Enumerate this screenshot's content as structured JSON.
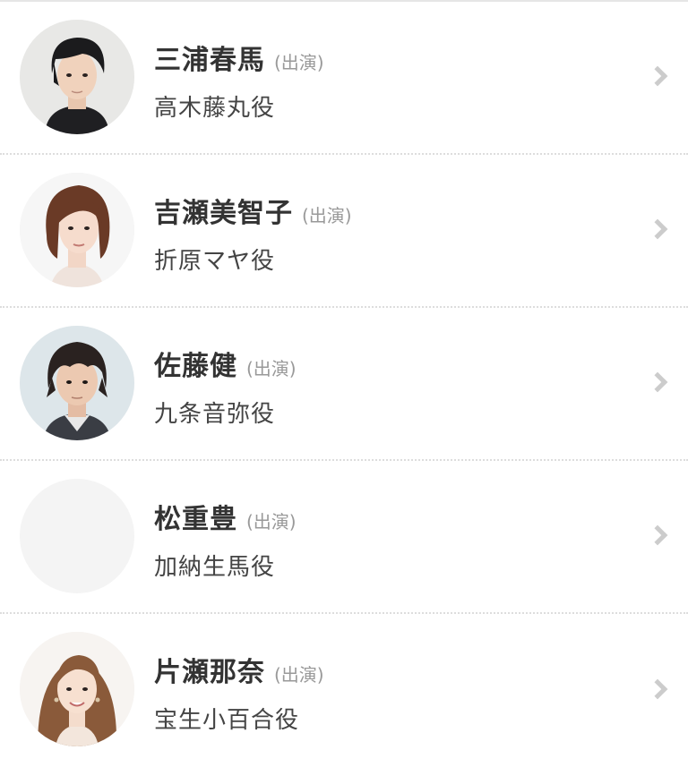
{
  "cast": [
    {
      "name": "三浦春馬",
      "credit": "(出演)",
      "role": "高木藤丸役",
      "photo": "photo-man-dark-hair"
    },
    {
      "name": "吉瀬美智子",
      "credit": "(出演)",
      "role": "折原マヤ役",
      "photo": "photo-woman-short-hair"
    },
    {
      "name": "佐藤健",
      "credit": "(出演)",
      "role": "九条音弥役",
      "photo": "photo-man-shaggy-hair"
    },
    {
      "name": "松重豊",
      "credit": "(出演)",
      "role": "加納生馬役",
      "photo": "placeholder"
    },
    {
      "name": "片瀬那奈",
      "credit": "(出演)",
      "role": "宝生小百合役",
      "photo": "photo-woman-long-hair"
    }
  ],
  "colors": {
    "name": "#333333",
    "credit": "#999999",
    "role": "#444444",
    "chevron": "#cccccc",
    "divider": "#dddddd"
  }
}
